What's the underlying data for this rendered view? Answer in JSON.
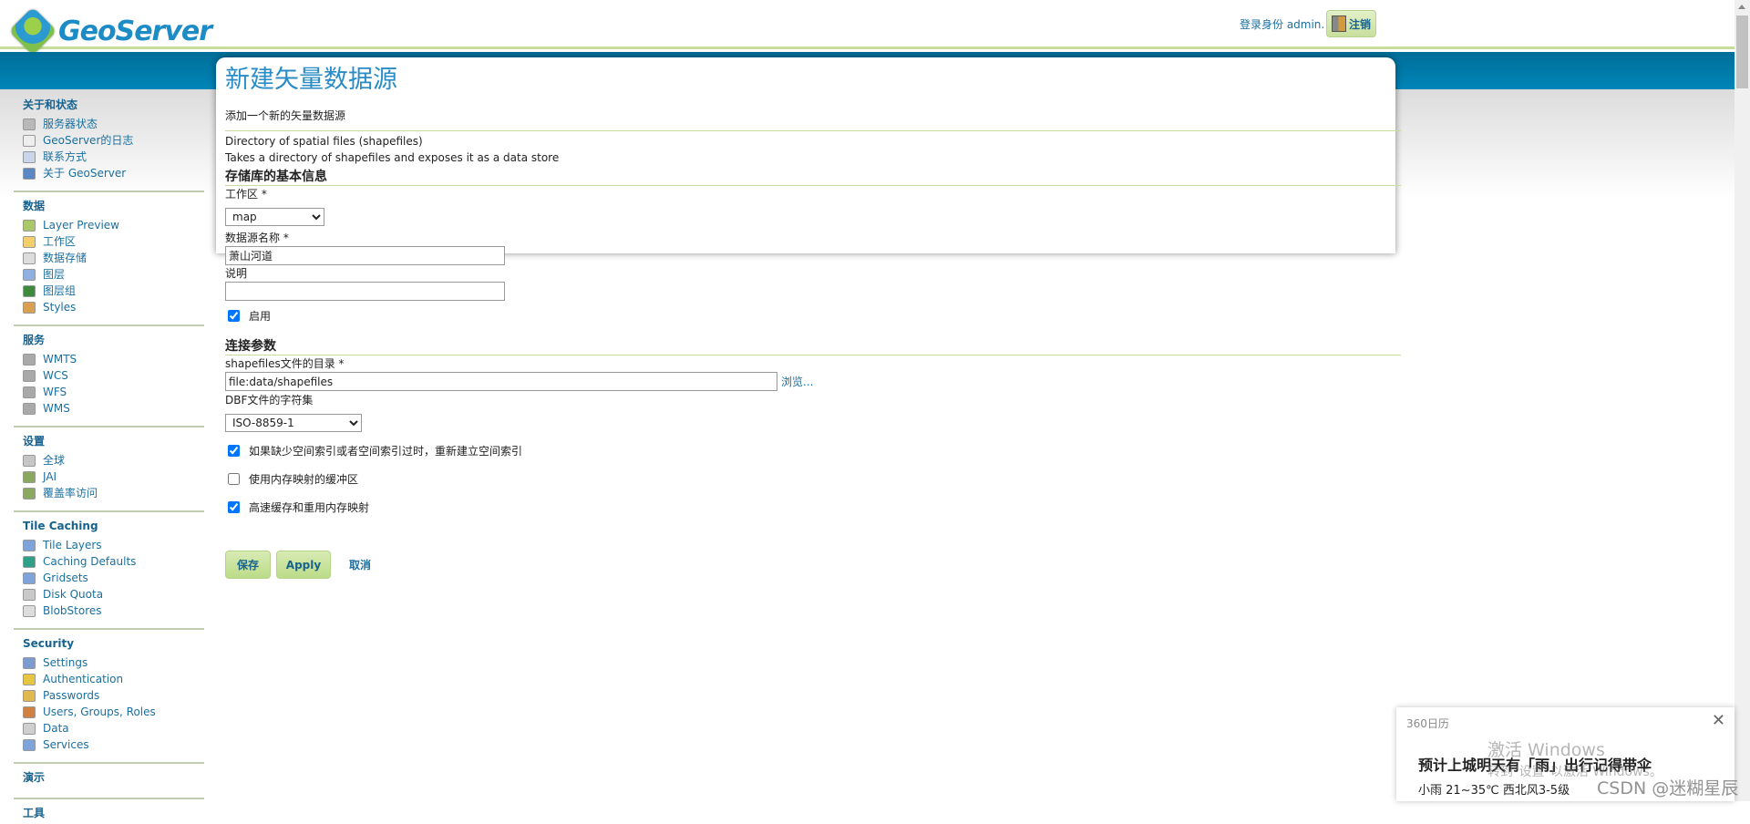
{
  "header": {
    "logo_text": "GeoServer",
    "login_text": "登录身份 admin.",
    "logout_label": "注销"
  },
  "sidebar": [
    {
      "title": "关于和状态",
      "items": [
        {
          "label": "服务器状态",
          "icon": "server-status-icon"
        },
        {
          "label": "GeoServer的日志",
          "icon": "log-icon"
        },
        {
          "label": "联系方式",
          "icon": "contact-icon"
        },
        {
          "label": "关于 GeoServer",
          "icon": "help-icon"
        }
      ]
    },
    {
      "title": "数据",
      "items": [
        {
          "label": "Layer Preview",
          "icon": "layer-preview-icon"
        },
        {
          "label": "工作区",
          "icon": "folder-icon"
        },
        {
          "label": "数据存储",
          "icon": "database-icon"
        },
        {
          "label": "图层",
          "icon": "layer-icon"
        },
        {
          "label": "图层组",
          "icon": "layer-group-icon"
        },
        {
          "label": "Styles",
          "icon": "palette-icon"
        }
      ]
    },
    {
      "title": "服务",
      "items": [
        {
          "label": "WMTS",
          "icon": "service-icon"
        },
        {
          "label": "WCS",
          "icon": "service-icon"
        },
        {
          "label": "WFS",
          "icon": "service-icon"
        },
        {
          "label": "WMS",
          "icon": "service-icon"
        }
      ]
    },
    {
      "title": "设置",
      "items": [
        {
          "label": "全球",
          "icon": "server-icon"
        },
        {
          "label": "JAI",
          "icon": "image-settings-icon"
        },
        {
          "label": "覆盖率访问",
          "icon": "image-settings-icon"
        }
      ]
    },
    {
      "title": "Tile Caching",
      "items": [
        {
          "label": "Tile Layers",
          "icon": "tile-icon"
        },
        {
          "label": "Caching Defaults",
          "icon": "globe-icon"
        },
        {
          "label": "Gridsets",
          "icon": "grid-icon"
        },
        {
          "label": "Disk Quota",
          "icon": "disk-icon"
        },
        {
          "label": "BlobStores",
          "icon": "database-icon"
        }
      ]
    },
    {
      "title": "Security",
      "items": [
        {
          "label": "Settings",
          "icon": "wrench-icon"
        },
        {
          "label": "Authentication",
          "icon": "shield-icon"
        },
        {
          "label": "Passwords",
          "icon": "lock-icon"
        },
        {
          "label": "Users, Groups, Roles",
          "icon": "users-icon"
        },
        {
          "label": "Data",
          "icon": "data-key-icon"
        },
        {
          "label": "Services",
          "icon": "service-key-icon"
        }
      ]
    },
    {
      "title": "演示",
      "items": []
    },
    {
      "title": "工具",
      "items": []
    }
  ],
  "main": {
    "title": "新建矢量数据源",
    "subtitle": "添加一个新的矢量数据源",
    "store_type": "Directory of spatial files (shapefiles)",
    "store_desc": "Takes a directory of shapefiles and exposes it as a data store",
    "basic_section": "存储库的基本信息",
    "workspace_label": "工作区 *",
    "workspace_value": "map",
    "name_label": "数据源名称 *",
    "name_value": "萧山河道",
    "desc_label": "说明",
    "desc_value": "",
    "enabled_label": "启用",
    "enabled": true,
    "conn_section": "连接参数",
    "dir_label": "shapefiles文件的目录 *",
    "dir_value": "file:data/shapefiles",
    "browse_label": "浏览...",
    "charset_label": "DBF文件的字符集",
    "charset_value": "ISO-8859-1",
    "opt1_label": "如果缺少空间索引或者空间索引过时，重新建立空间索引",
    "opt1": true,
    "opt2_label": "使用内存映射的缓冲区",
    "opt2": false,
    "opt3_label": "高速缓存和重用内存映射",
    "opt3": true,
    "save_label": "保存",
    "apply_label": "Apply",
    "cancel_label": "取消"
  },
  "popup": {
    "app": "360日历",
    "headline": "预计上城明天有「雨」出行记得带伞",
    "detail": "小雨 21~35℃ 西北风3-5级"
  },
  "watermark": {
    "line1": "激活 Windows",
    "line2": "转到\"设置\"以激活 Windows。",
    "csdn": "CSDN @迷糊星辰"
  }
}
